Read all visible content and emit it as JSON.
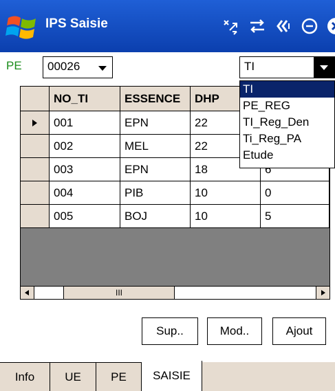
{
  "window": {
    "title": "IPS Saisie"
  },
  "status_icons": [
    "connectivity-icon",
    "sync-icon",
    "volume-icon",
    "clock-icon",
    "close-icon"
  ],
  "filters": {
    "pe_label": "PE",
    "pe_value": "00026",
    "table_value": "TI",
    "table_options": [
      "TI",
      "PE_REG",
      "TI_Reg_Den",
      "Ti_Reg_PA",
      "Etude"
    ],
    "table_selected_index": 0
  },
  "grid": {
    "columns": [
      "NO_TI",
      "ESSENCE",
      "DHP",
      ""
    ],
    "rows": [
      [
        "001",
        "EPN",
        "22",
        ""
      ],
      [
        "002",
        "MEL",
        "22",
        ""
      ],
      [
        "003",
        "EPN",
        "18",
        "6"
      ],
      [
        "004",
        "PIB",
        "10",
        "0"
      ],
      [
        "005",
        "BOJ",
        "10",
        "5"
      ]
    ],
    "current_row_index": 0
  },
  "scrollbar": {
    "thumb_label": "III"
  },
  "buttons": {
    "delete": "Sup..",
    "modify": "Mod..",
    "add": "Ajout"
  },
  "tabs": [
    "Info",
    "UE",
    "PE",
    "SAISIE"
  ],
  "active_tab": "SAISIE",
  "colors": {
    "titlebar": "#0b3fae",
    "accent_green": "#1a8c1a",
    "grid_header_bg": "#e6dcd0",
    "selected_option_bg": "#0a246a"
  }
}
